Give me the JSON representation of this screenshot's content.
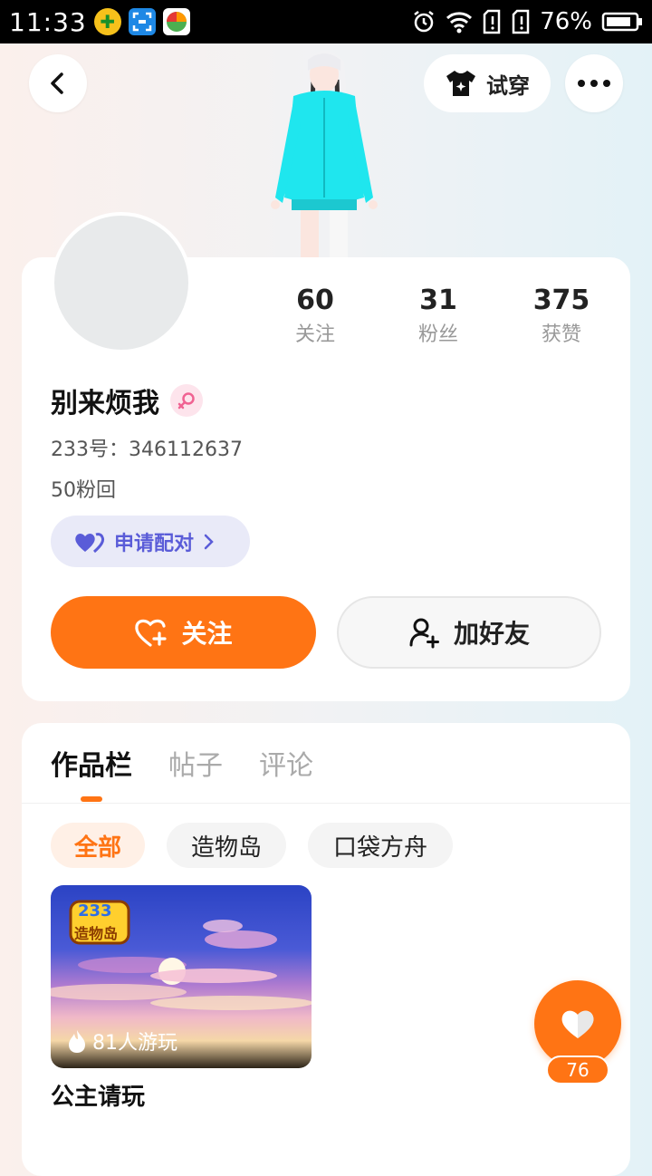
{
  "status_bar": {
    "time": "11:33",
    "battery": "76%"
  },
  "header": {
    "try_on_label": "试穿"
  },
  "profile": {
    "name": "别来烦我",
    "id_text": "233号：346112637",
    "bio": "50粉回",
    "stats": [
      {
        "value": "60",
        "label": "关注"
      },
      {
        "value": "31",
        "label": "粉丝"
      },
      {
        "value": "375",
        "label": "获赞"
      }
    ],
    "pair_label": "申请配对",
    "follow_label": "关注",
    "add_friend_label": "加好友"
  },
  "tabs": [
    {
      "label": "作品栏",
      "active": true
    },
    {
      "label": "帖子",
      "active": false
    },
    {
      "label": "评论",
      "active": false
    }
  ],
  "filters": [
    {
      "label": "全部",
      "active": true
    },
    {
      "label": "造物岛",
      "active": false
    },
    {
      "label": "口袋方舟",
      "active": false
    }
  ],
  "works": [
    {
      "title": "公主请玩",
      "plays": "81人游玩",
      "badge_top": "233",
      "badge_bottom": "造物岛"
    }
  ],
  "like_fab": {
    "count": "76"
  },
  "colors": {
    "accent": "#ff7414",
    "pair_purple": "#5a5cd8"
  }
}
